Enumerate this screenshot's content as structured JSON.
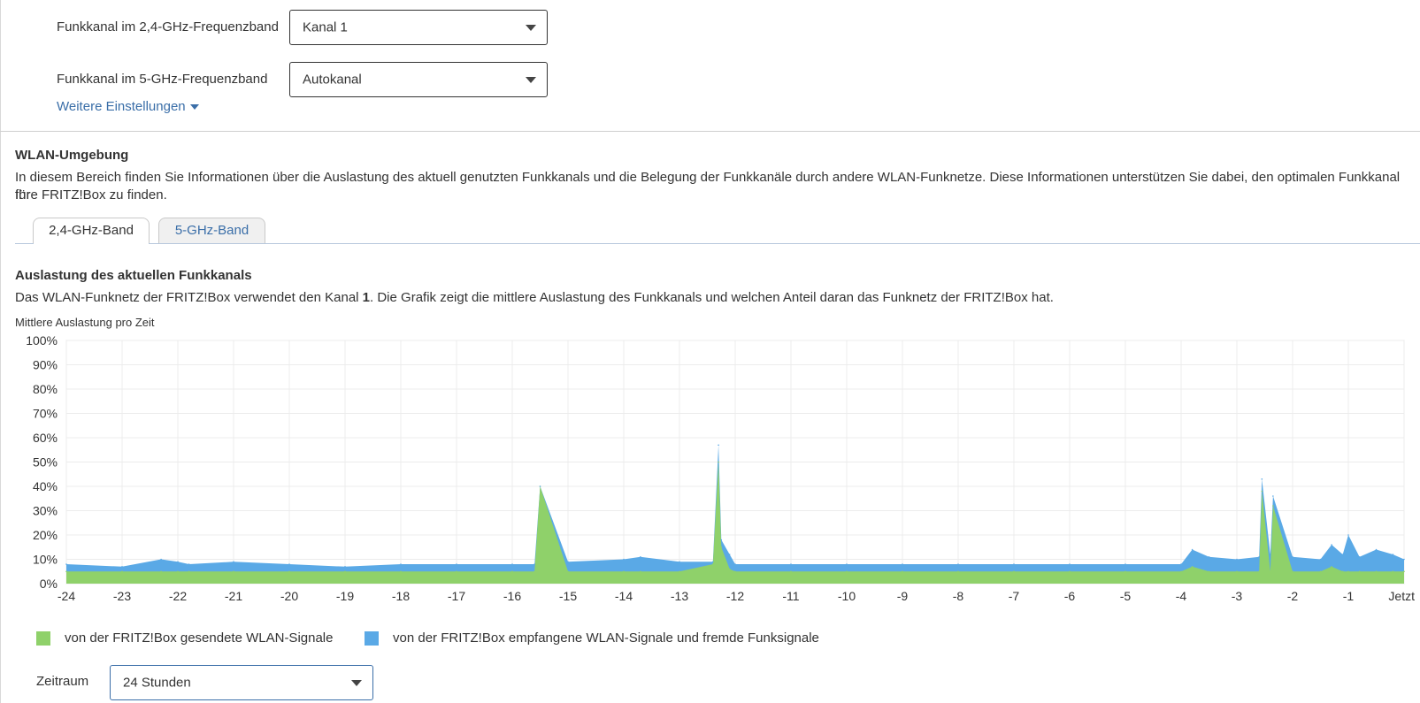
{
  "settings": {
    "channel_24_label": "Funkkanal im 2,4-GHz-Frequenzband",
    "channel_24_value": "Kanal 1",
    "channel_5_label": "Funkkanal im 5-GHz-Frequenzband",
    "channel_5_value": "Autokanal",
    "more_settings": "Weitere Einstellungen"
  },
  "environment": {
    "title": "WLAN-Umgebung",
    "description_line1": "In diesem Bereich finden Sie Informationen über die Auslastung des aktuell genutzten Funkkanals und die Belegung der Funkkanäle durch andere WLAN-Funknetze. Diese Informationen unterstützen Sie dabei, den optimalen Funkkanal für",
    "description_line2": "Ihre FRITZ!Box zu finden.",
    "tabs": [
      {
        "label": "2,4-GHz-Band",
        "active": true
      },
      {
        "label": "5-GHz-Band",
        "active": false
      }
    ]
  },
  "utilization": {
    "title": "Auslastung des aktuellen Funkkanals",
    "desc_before": "Das WLAN-Funknetz der FRITZ!Box verwendet den Kanal ",
    "desc_channel": "1",
    "desc_after": ". Die Grafik zeigt die mittlere Auslastung des Funkkanals und welchen Anteil daran das Funknetz der FRITZ!Box hat.",
    "chart_caption": "Mittlere Auslastung pro Zeit"
  },
  "colors": {
    "sent": "#8fd16a",
    "received": "#5aa9e6"
  },
  "chart_data": {
    "type": "area",
    "title": "Mittlere Auslastung pro Zeit",
    "xlabel": "",
    "ylabel": "",
    "ylim": [
      0,
      100
    ],
    "xlim": [
      -24,
      0
    ],
    "y_ticks": [
      "100%",
      "90%",
      "80%",
      "70%",
      "60%",
      "50%",
      "40%",
      "30%",
      "20%",
      "10%",
      "0%"
    ],
    "x_ticks": [
      "-24",
      "-23",
      "-22",
      "-21",
      "-20",
      "-19",
      "-18",
      "-17",
      "-16",
      "-15",
      "-14",
      "-13",
      "-12",
      "-11",
      "-10",
      "-9",
      "-8",
      "-7",
      "-6",
      "-5",
      "-4",
      "-3",
      "-2",
      "-1",
      "Jetzt"
    ],
    "grid": true,
    "legend_position": "bottom",
    "x": [
      -24,
      -23,
      -22.3,
      -22,
      -21.8,
      -21,
      -20,
      -19,
      -18,
      -17,
      -16,
      -15.6,
      -15.5,
      -15,
      -14,
      -13.7,
      -13,
      -12.4,
      -12.3,
      -12.25,
      -12.1,
      -12,
      -11,
      -10,
      -9,
      -8,
      -7,
      -6,
      -5,
      -4,
      -3.8,
      -3.5,
      -3,
      -2.6,
      -2.55,
      -2.4,
      -2.35,
      -2,
      -1.5,
      -1.3,
      -1.1,
      -1,
      -0.8,
      -0.5,
      -0.2,
      0
    ],
    "series": [
      {
        "name": "von der FRITZ!Box gesendete WLAN-Signale",
        "values": [
          5,
          5,
          5,
          5,
          5,
          5,
          5,
          5,
          5,
          5,
          5,
          5,
          40,
          5,
          5,
          5,
          5,
          8,
          50,
          15,
          6,
          5,
          5,
          5,
          5,
          5,
          5,
          5,
          5,
          5,
          7,
          5,
          5,
          5,
          38,
          5,
          32,
          5,
          5,
          7,
          5,
          5,
          5,
          5,
          5,
          5
        ]
      },
      {
        "name": "von der FRITZ!Box empfangene WLAN-Signale und fremde Funksignale",
        "values": [
          8,
          7,
          10,
          9,
          8,
          9,
          8,
          7,
          8,
          8,
          8,
          8,
          40,
          9,
          10,
          11,
          9,
          9,
          57,
          18,
          12,
          8,
          8,
          8,
          8,
          8,
          8,
          8,
          8,
          8,
          14,
          11,
          10,
          11,
          43,
          12,
          36,
          11,
          10,
          16,
          12,
          20,
          11,
          14,
          12,
          10
        ]
      }
    ]
  },
  "legend": {
    "sent": "von der FRITZ!Box gesendete WLAN-Signale",
    "received": "von der FRITZ!Box empfangene WLAN-Signale und fremde Funksignale"
  },
  "period": {
    "label": "Zeitraum",
    "value": "24 Stunden"
  }
}
